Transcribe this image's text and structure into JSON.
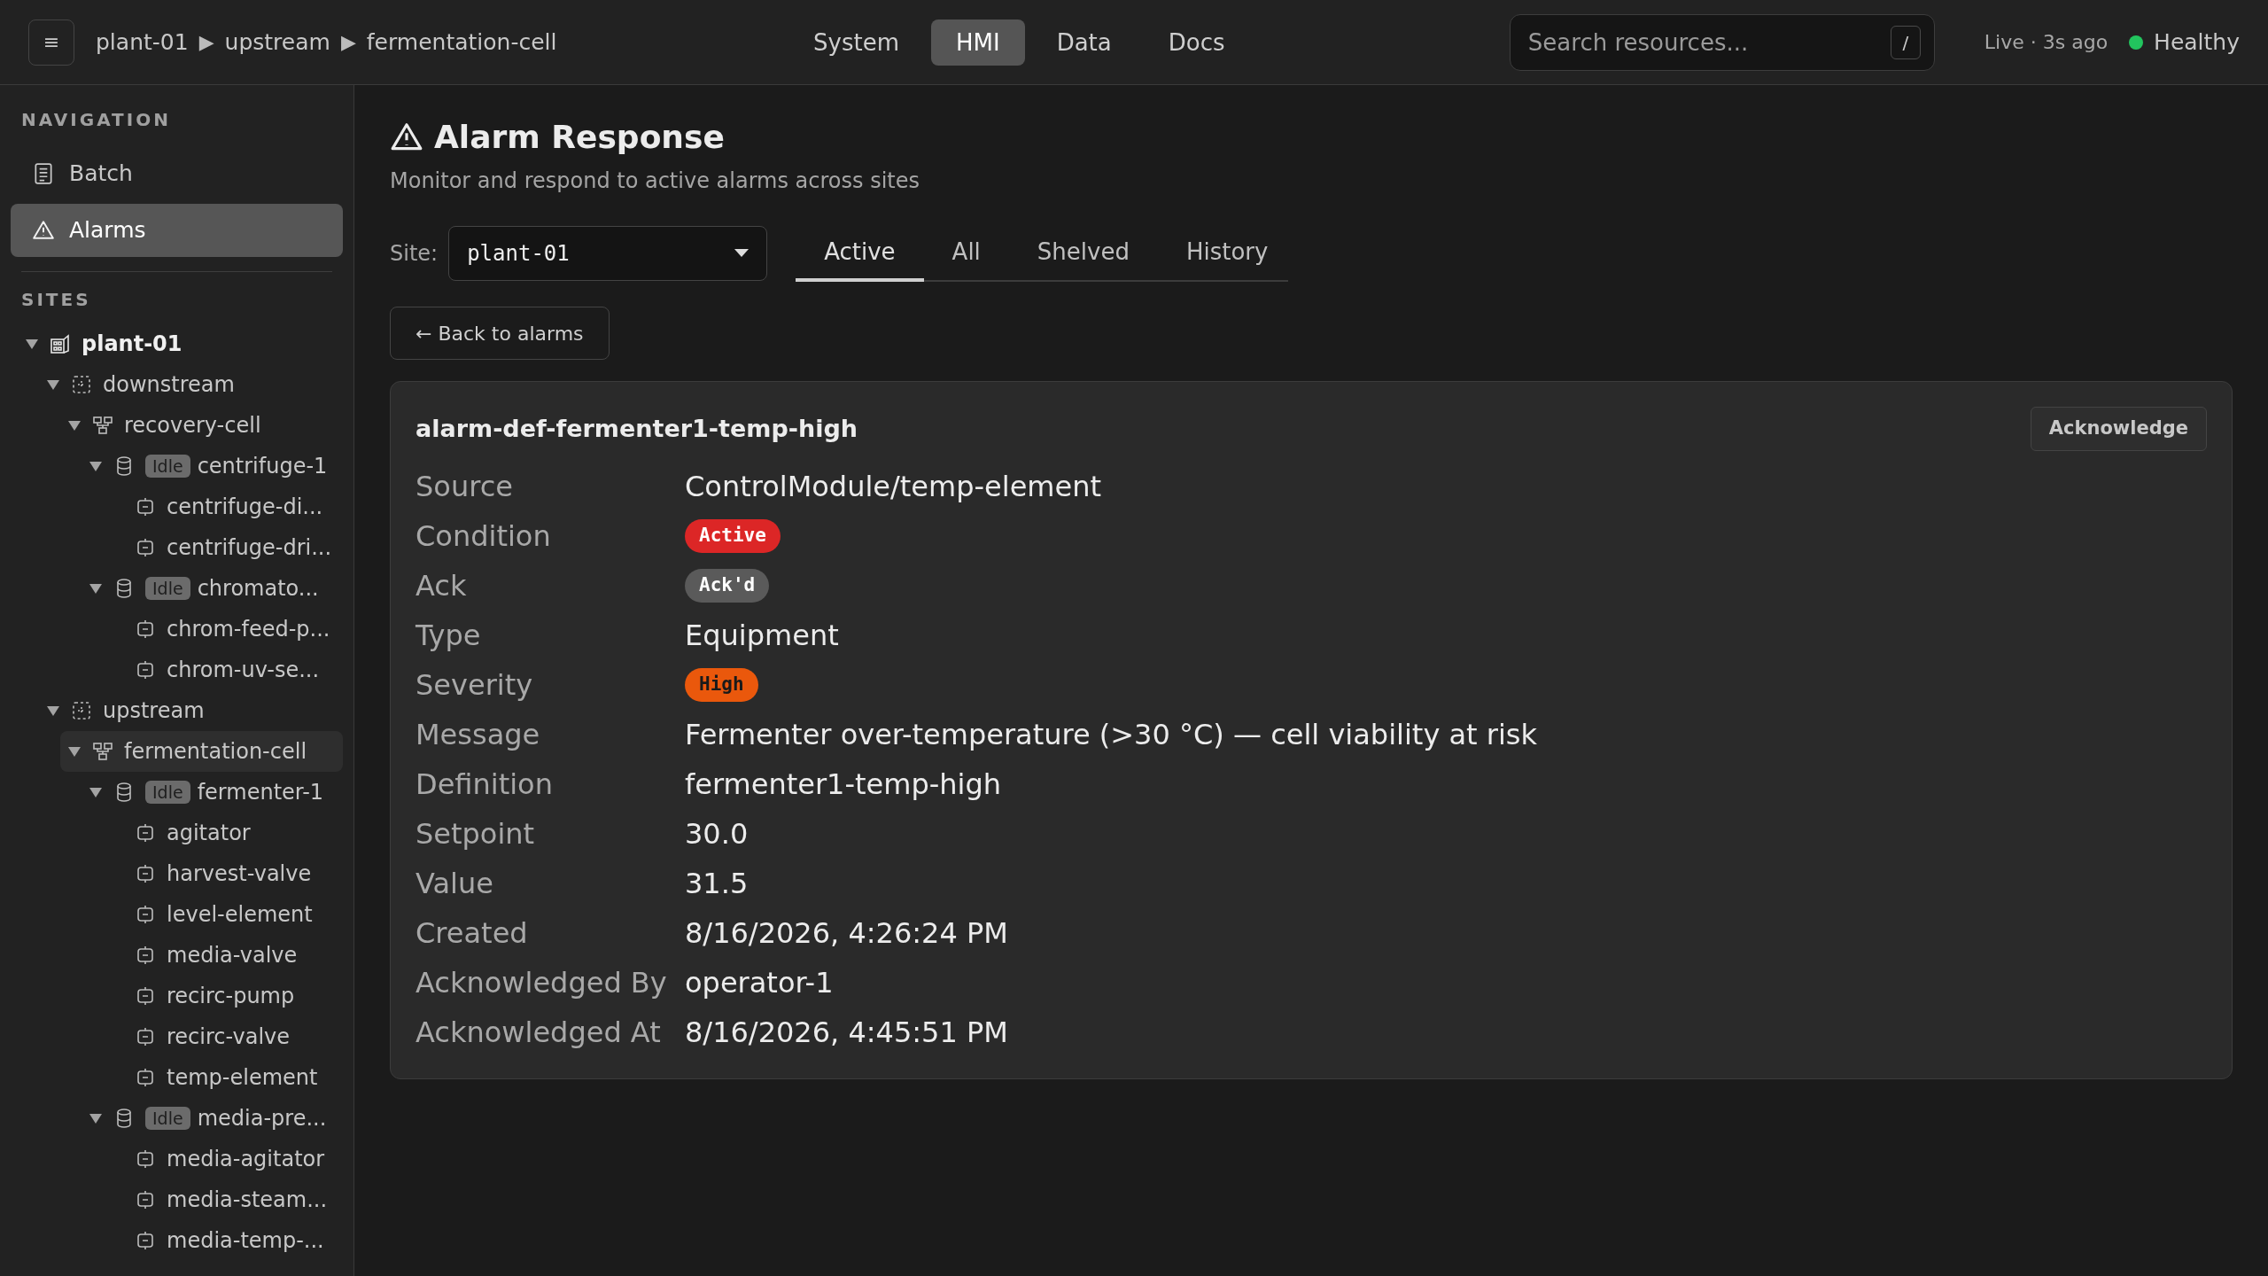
{
  "top_bar": {
    "menu_button": "≡",
    "breadcrumb": [
      "plant-01",
      "upstream",
      "fermentation-cell"
    ],
    "breadcrumb_separator": "▶",
    "nav": [
      {
        "label": "System",
        "selected": false
      },
      {
        "label": "HMI",
        "selected": true
      },
      {
        "label": "Data",
        "selected": false
      },
      {
        "label": "Docs",
        "selected": false
      }
    ],
    "search": {
      "placeholder": "Search resources...",
      "shortcut": "/"
    },
    "live": "Live · 3s ago",
    "health": {
      "label": "Healthy",
      "color": "#22c55e"
    }
  },
  "sidebar": {
    "navigation_heading": "NAVIGATION",
    "items": [
      {
        "label": "Batch",
        "kind": "batch",
        "selected": false
      },
      {
        "label": "Alarms",
        "kind": "alarm",
        "selected": true
      }
    ],
    "sites_heading": "SITES",
    "tree": [
      {
        "label": "plant-01",
        "kind": "site",
        "expanded": true,
        "selected": false,
        "children": [
          {
            "label": "downstream",
            "kind": "area",
            "expanded": true,
            "selected": false,
            "children": [
              {
                "label": "recovery-cell",
                "kind": "cell",
                "expanded": true,
                "selected": false,
                "children": [
                  {
                    "label": "centrifuge-1",
                    "kind": "unit",
                    "badge": "Idle",
                    "expanded": true,
                    "selected": false,
                    "children": [
                      {
                        "label": "centrifuge-di...",
                        "kind": "module",
                        "selected": false
                      },
                      {
                        "label": "centrifuge-dri...",
                        "kind": "module",
                        "selected": false
                      }
                    ]
                  },
                  {
                    "label": "chromato...",
                    "kind": "unit",
                    "badge": "Idle",
                    "expanded": true,
                    "selected": false,
                    "children": [
                      {
                        "label": "chrom-feed-p...",
                        "kind": "module",
                        "selected": false
                      },
                      {
                        "label": "chrom-uv-se...",
                        "kind": "module",
                        "selected": false
                      }
                    ]
                  }
                ]
              }
            ]
          },
          {
            "label": "upstream",
            "kind": "area",
            "expanded": true,
            "selected": false,
            "children": [
              {
                "label": "fermentation-cell",
                "kind": "cell",
                "expanded": true,
                "selected": true,
                "children": [
                  {
                    "label": "fermenter-1",
                    "kind": "unit",
                    "badge": "Idle",
                    "expanded": true,
                    "selected": false,
                    "children": [
                      {
                        "label": "agitator",
                        "kind": "module",
                        "selected": false
                      },
                      {
                        "label": "harvest-valve",
                        "kind": "module",
                        "selected": false
                      },
                      {
                        "label": "level-element",
                        "kind": "module",
                        "selected": false
                      },
                      {
                        "label": "media-valve",
                        "kind": "module",
                        "selected": false
                      },
                      {
                        "label": "recirc-pump",
                        "kind": "module",
                        "selected": false
                      },
                      {
                        "label": "recirc-valve",
                        "kind": "module",
                        "selected": false
                      },
                      {
                        "label": "temp-element",
                        "kind": "module",
                        "selected": false
                      }
                    ]
                  },
                  {
                    "label": "media-pre...",
                    "kind": "unit",
                    "badge": "Idle",
                    "expanded": true,
                    "selected": false,
                    "children": [
                      {
                        "label": "media-agitator",
                        "kind": "module",
                        "selected": false
                      },
                      {
                        "label": "media-steam...",
                        "kind": "module",
                        "selected": false
                      },
                      {
                        "label": "media-temp-...",
                        "kind": "module",
                        "selected": false
                      }
                    ]
                  }
                ]
              }
            ]
          }
        ]
      }
    ]
  },
  "page": {
    "title": "Alarm Response",
    "subtitle": "Monitor and respond to active alarms across sites",
    "site_label": "Site:",
    "site_value": "plant-01",
    "tabs": [
      {
        "label": "Active",
        "selected": true
      },
      {
        "label": "All",
        "selected": false
      },
      {
        "label": "Shelved",
        "selected": false
      },
      {
        "label": "History",
        "selected": false
      }
    ],
    "back_button": "← Back to alarms"
  },
  "alarm": {
    "title": "alarm-def-fermenter1-temp-high",
    "action": "Acknowledge",
    "fields": [
      {
        "label": "Source",
        "value": "ControlModule/temp-element",
        "kind": "text"
      },
      {
        "label": "Condition",
        "value": "Active",
        "kind": "badge",
        "color": "#dc2626"
      },
      {
        "label": "Ack",
        "value": "Ack'd",
        "kind": "badge",
        "color": "#5a5a5a"
      },
      {
        "label": "Type",
        "value": "Equipment",
        "kind": "text"
      },
      {
        "label": "Severity",
        "value": "High",
        "kind": "badge",
        "color": "#ea580c"
      },
      {
        "label": "Message",
        "value": "Fermenter over-temperature (>30 °C) — cell viability at risk",
        "kind": "text"
      },
      {
        "label": "Definition",
        "value": "fermenter1-temp-high",
        "kind": "text"
      },
      {
        "label": "Setpoint",
        "value": "30.0",
        "kind": "text"
      },
      {
        "label": "Value",
        "value": "31.5",
        "kind": "text"
      },
      {
        "label": "Created",
        "value": "8/16/2026, 4:26:24 PM",
        "kind": "text"
      },
      {
        "label": "Acknowledged By",
        "value": "operator-1",
        "kind": "text"
      },
      {
        "label": "Acknowledged At",
        "value": "8/16/2026, 4:45:51 PM",
        "kind": "text"
      }
    ]
  }
}
